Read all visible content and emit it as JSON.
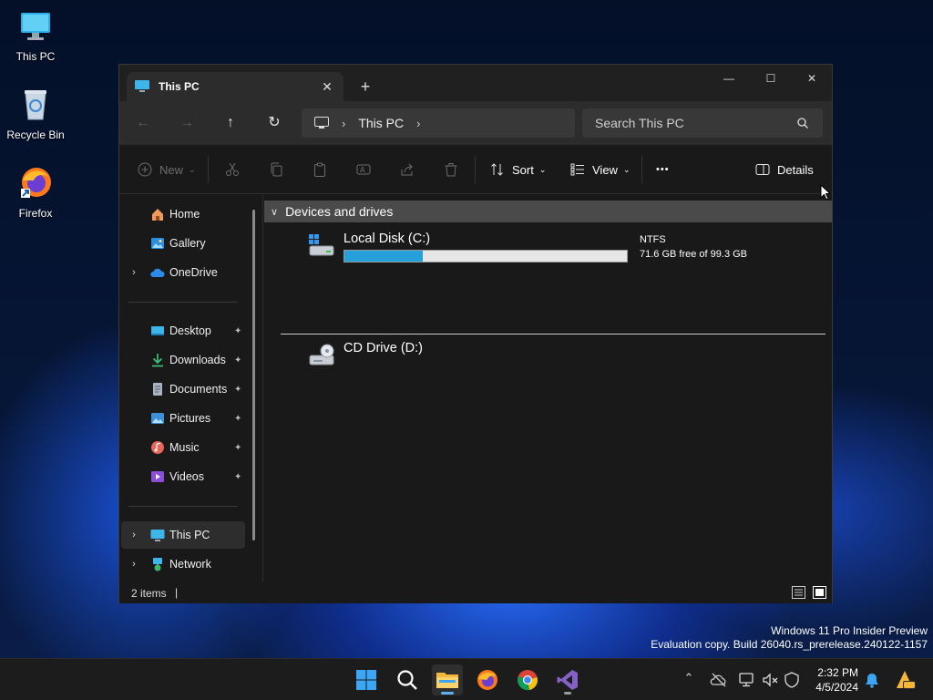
{
  "desktop": {
    "icons": [
      {
        "label": "This PC"
      },
      {
        "label": "Recycle Bin"
      },
      {
        "label": "Firefox"
      }
    ],
    "watermark_line1": "Windows 11 Pro Insider Preview",
    "watermark_line2": "Evaluation copy. Build 26040.rs_prerelease.240122-1157"
  },
  "window": {
    "tab_title": "This PC",
    "tab_close": "✕",
    "new_tab": "+",
    "controls": {
      "minimize": "—",
      "maximize": "☐",
      "close": "✕"
    },
    "nav": {
      "back": "←",
      "forward": "→",
      "up": "↑",
      "refresh": "↻"
    },
    "address": {
      "separator": "›",
      "crumb": "This PC",
      "trailing": "›"
    },
    "search": {
      "placeholder": "Search This PC"
    },
    "toolbar": {
      "new_label": "New",
      "sort_label": "Sort",
      "view_label": "View",
      "more_label": "•••",
      "details_label": "Details",
      "dropdown": "⌄"
    },
    "sidebar": {
      "items": [
        {
          "label": "Home",
          "icon": "home-icon"
        },
        {
          "label": "Gallery",
          "icon": "gallery-icon"
        },
        {
          "label": "OneDrive",
          "icon": "onedrive-icon",
          "expand": "›"
        },
        {
          "label": "Desktop",
          "icon": "desktop-folder-icon",
          "pinned": true
        },
        {
          "label": "Downloads",
          "icon": "downloads-icon",
          "pinned": true
        },
        {
          "label": "Documents",
          "icon": "documents-icon",
          "pinned": true
        },
        {
          "label": "Pictures",
          "icon": "pictures-icon",
          "pinned": true
        },
        {
          "label": "Music",
          "icon": "music-icon",
          "pinned": true
        },
        {
          "label": "Videos",
          "icon": "videos-icon",
          "pinned": true
        },
        {
          "label": "This PC",
          "icon": "this-pc-icon",
          "expand": "›",
          "selected": true
        },
        {
          "label": "Network",
          "icon": "network-icon",
          "expand": "›"
        }
      ],
      "pin_glyph": "✦"
    },
    "content": {
      "group_chevron": "∨",
      "group_title": "Devices and drives",
      "drives": [
        {
          "name": "Local Disk (C:)",
          "filesystem": "NTFS",
          "free_text": "71.6 GB free of 99.3 GB",
          "used_fraction": 0.279
        },
        {
          "name": "CD Drive (D:)"
        }
      ]
    },
    "status": {
      "item_count": "2 items",
      "caret": "|"
    }
  },
  "taskbar": {
    "apps": [
      "start-icon",
      "search-icon",
      "file-explorer-icon",
      "firefox-icon",
      "chrome-icon",
      "visual-studio-icon"
    ],
    "tray_chevron": "⌃",
    "clock_time": "2:32 PM",
    "clock_date": "4/5/2024"
  },
  "colors": {
    "accent": "#26a0da",
    "window_bg": "#191919",
    "titlebar_bg": "#202020",
    "group_header_bg": "#4a4a4a"
  }
}
